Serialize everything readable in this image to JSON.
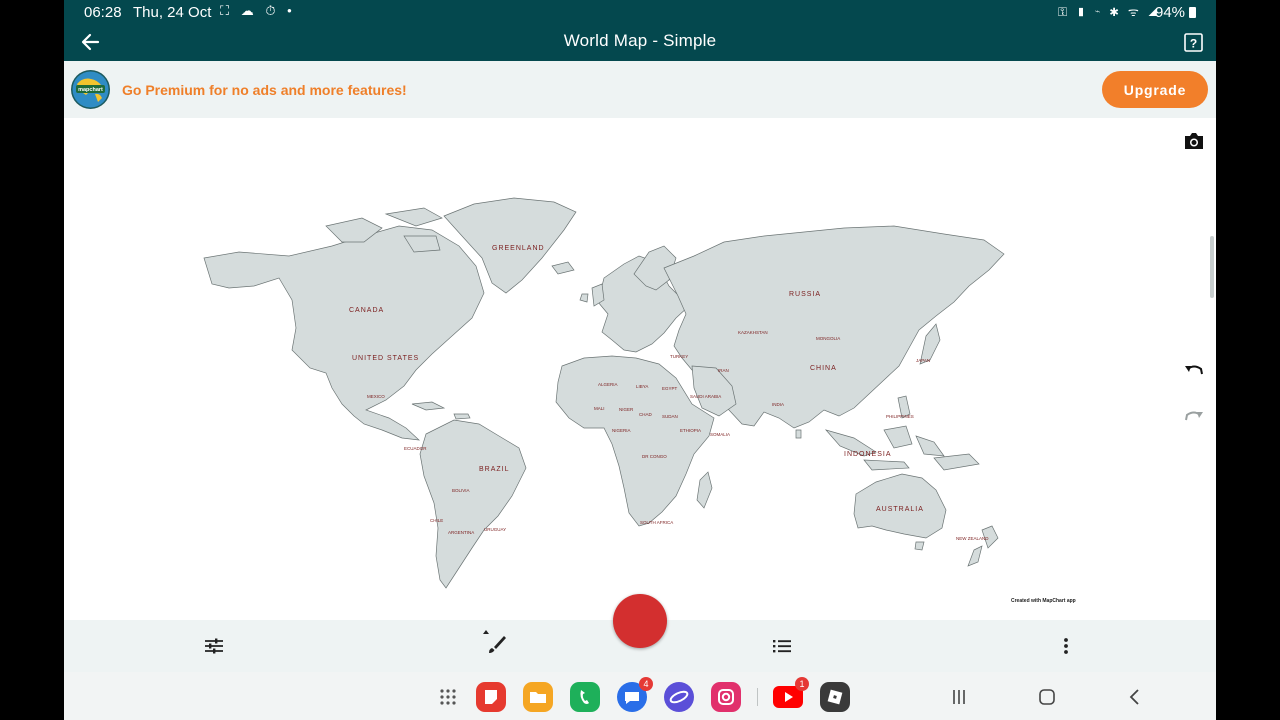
{
  "status_bar": {
    "time": "06:28",
    "date": "Thu, 24 Oct",
    "left_icons": "⛶ ☁ ⏱ •",
    "right_icons": "⚿ ▮ ⌁ ✱ ᯤ ◢",
    "battery": "94%"
  },
  "app_bar": {
    "title": "World Map - Simple",
    "back_icon": "arrow-left",
    "help_icon": "help-box"
  },
  "banner": {
    "logo_text": "mapchart",
    "text": "Go Premium for no ads and more features!",
    "upgrade_label": "Upgrade"
  },
  "map": {
    "credit": "Created with MapChart app",
    "labels": {
      "greenland": "GREENLAND",
      "canada": "CANADA",
      "united_states": "UNITED STATES",
      "mexico": "MEXICO",
      "brazil": "BRAZIL",
      "bolivia": "BOLIVIA",
      "chile": "CHILE",
      "argentina": "ARGENTINA",
      "russia": "RUSSIA",
      "kazakhstan": "KAZAKHSTAN",
      "mongolia": "MONGOLIA",
      "china": "CHINA",
      "india": "INDIA",
      "iran": "IRAN",
      "turkey": "TURKEY",
      "algeria": "ALGERIA",
      "libya": "LIBYA",
      "egypt": "EGYPT",
      "mali": "MALI",
      "niger": "NIGER",
      "chad": "CHAD",
      "sudan": "SUDAN",
      "nigeria": "NIGERIA",
      "ethiopia": "ETHIOPIA",
      "somalia": "SOMALIA",
      "dr_congo": "DR CONGO",
      "south_africa": "SOUTH AFRICA",
      "saudi_arabia": "SAUDI ARABIA",
      "indonesia": "INDONESIA",
      "philippines": "PHILIPPINES",
      "australia": "AUSTRALIA",
      "new_zealand": "NEW ZEALAND",
      "japan": "JAPAN",
      "ecuador": "ECUADOR",
      "uruguay": "URUGUAY"
    }
  },
  "side_tools": {
    "camera_icon": "camera",
    "undo_icon": "undo",
    "redo_icon": "redo"
  },
  "toolbar": {
    "settings_icon": "sliders",
    "brush_icon": "brush",
    "list_icon": "list",
    "more_icon": "more-vertical",
    "record_color": "#d32f2f"
  },
  "dock": {
    "apps": [
      {
        "name": "app-grid",
        "color": "#555555"
      },
      {
        "name": "samsung-notes",
        "color": "#e63a2f"
      },
      {
        "name": "my-files",
        "color": "#f5a623"
      },
      {
        "name": "phone",
        "color": "#1eb05a"
      },
      {
        "name": "messages",
        "color": "#2a6ee8",
        "badge": "4"
      },
      {
        "name": "internet",
        "color": "#5b4fd8"
      },
      {
        "name": "instagram",
        "color": "#e1306c"
      },
      {
        "name": "youtube",
        "color": "#ff0000",
        "badge": "1"
      },
      {
        "name": "roblox",
        "color": "#3a3a3a"
      }
    ]
  }
}
